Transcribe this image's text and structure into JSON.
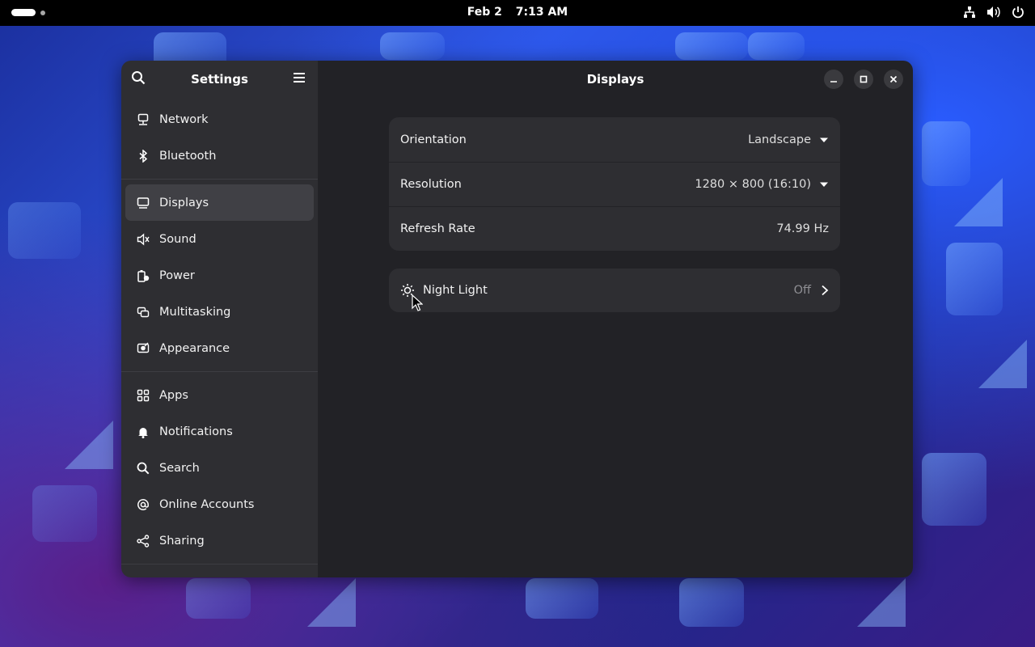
{
  "topbar": {
    "date": "Feb 2",
    "time": "7:13 AM",
    "tray_icons": [
      "network-icon",
      "volume-icon",
      "power-icon"
    ]
  },
  "sidebar": {
    "title": "Settings",
    "groups": [
      [
        {
          "label": "Network",
          "icon": "network-icon"
        },
        {
          "label": "Bluetooth",
          "icon": "bluetooth-icon"
        }
      ],
      [
        {
          "label": "Displays",
          "icon": "display-icon",
          "active": true
        },
        {
          "label": "Sound",
          "icon": "speaker-icon"
        },
        {
          "label": "Power",
          "icon": "power-battery-icon"
        },
        {
          "label": "Multitasking",
          "icon": "multitasking-icon"
        },
        {
          "label": "Appearance",
          "icon": "appearance-icon"
        }
      ],
      [
        {
          "label": "Apps",
          "icon": "apps-grid-icon"
        },
        {
          "label": "Notifications",
          "icon": "bell-icon"
        },
        {
          "label": "Search",
          "icon": "search-icon"
        },
        {
          "label": "Online Accounts",
          "icon": "at-sign-icon"
        },
        {
          "label": "Sharing",
          "icon": "share-icon"
        }
      ]
    ]
  },
  "main": {
    "title": "Displays",
    "settings": {
      "orientation": {
        "label": "Orientation",
        "value": "Landscape"
      },
      "resolution": {
        "label": "Resolution",
        "value": "1280 × 800 (16:10)"
      },
      "refresh_rate": {
        "label": "Refresh Rate",
        "value": "74.99 Hz"
      }
    },
    "night_light": {
      "label": "Night Light",
      "value": "Off"
    }
  },
  "colors": {
    "sidebar_bg": "#2e2e32",
    "main_bg": "#222226",
    "active_item": "#404045",
    "topbar": "#000000"
  }
}
